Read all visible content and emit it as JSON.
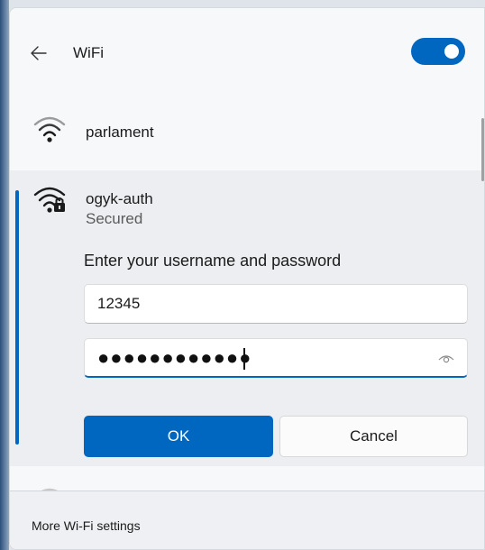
{
  "header": {
    "title": "WiFi",
    "back_icon": "back-arrow-icon",
    "toggle_state": "on"
  },
  "networks": [
    {
      "name": "parlament",
      "icon": "wifi-signal-icon"
    },
    {
      "name": "ogyk-auth",
      "status": "Secured",
      "icon": "wifi-secured-icon",
      "prompt": "Enter your username and password",
      "username_value": "12345",
      "password_value": "●●●●●●●●●●●●",
      "reveal_icon": "eye-icon",
      "ok_label": "OK",
      "cancel_label": "Cancel"
    }
  ],
  "footer": {
    "link_label": "More Wi-Fi settings"
  },
  "colors": {
    "accent": "#0067c0",
    "panel_bg": "#f7f8fa",
    "selected_bg": "#eceef1"
  }
}
